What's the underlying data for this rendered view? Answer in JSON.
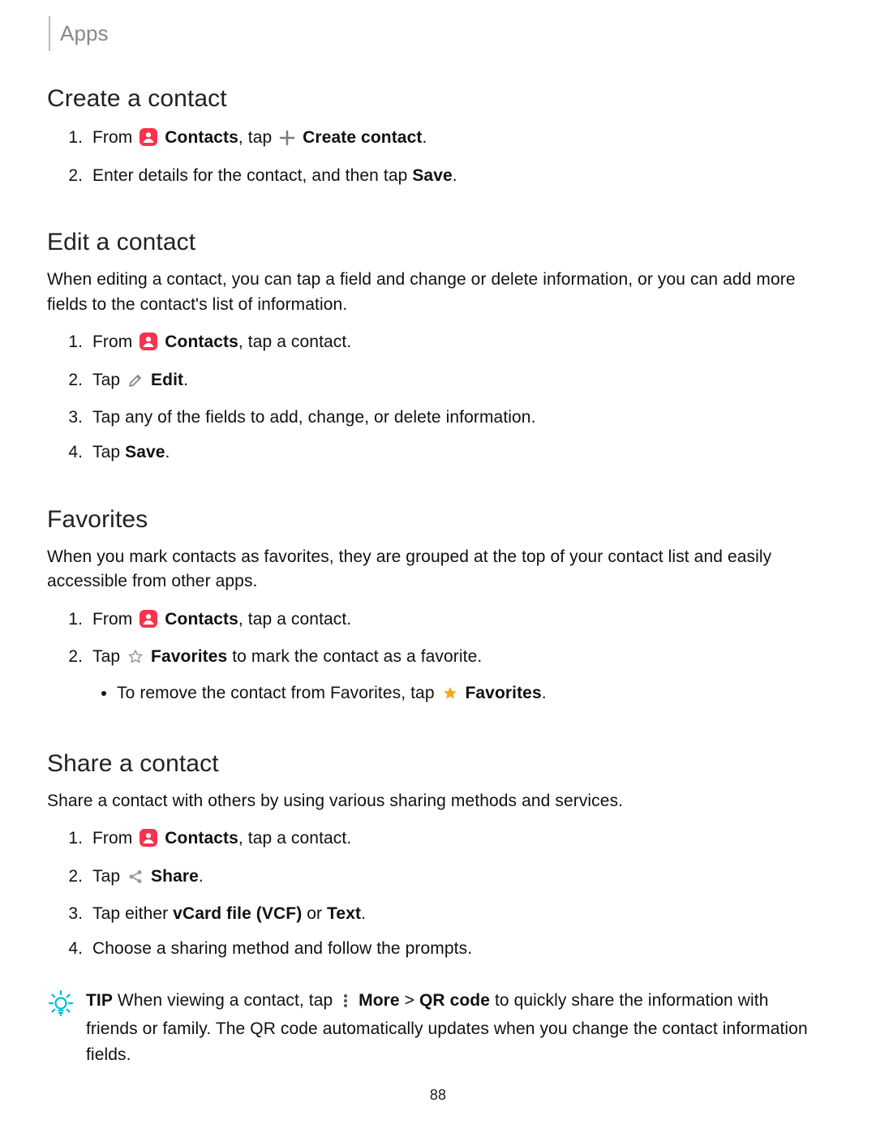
{
  "header": {
    "title": "Apps"
  },
  "section_create": {
    "heading": "Create a contact",
    "step1": {
      "pre": "From ",
      "contacts_label": "Contacts",
      "mid": ", tap ",
      "create_label": "Create contact",
      "post": "."
    },
    "step2": {
      "pre": "Enter details for the contact, and then tap ",
      "save": "Save",
      "post": "."
    }
  },
  "section_edit": {
    "heading": "Edit a contact",
    "intro": "When editing a contact, you can tap a field and change or delete information, or you can add more fields to the contact's list of information.",
    "step1": {
      "pre": "From ",
      "contacts_label": "Contacts",
      "post": ", tap a contact."
    },
    "step2": {
      "pre": "Tap ",
      "edit_label": "Edit",
      "post": "."
    },
    "step3": "Tap any of the fields to add, change, or delete information.",
    "step4": {
      "pre": "Tap ",
      "save": "Save",
      "post": "."
    }
  },
  "section_favorites": {
    "heading": "Favorites",
    "intro": "When you mark contacts as favorites, they are grouped at the top of your contact list and easily accessible from other apps.",
    "step1": {
      "pre": "From ",
      "contacts_label": "Contacts",
      "post": ", tap a contact."
    },
    "step2": {
      "pre": "Tap ",
      "fav_label": "Favorites",
      "post": " to mark the contact as a favorite."
    },
    "sub": {
      "pre": "To remove the contact from Favorites, tap ",
      "fav_label": "Favorites",
      "post": "."
    }
  },
  "section_share": {
    "heading": "Share a contact",
    "intro": "Share a contact with others by using various sharing methods and services.",
    "step1": {
      "pre": "From ",
      "contacts_label": "Contacts",
      "post": ", tap a contact."
    },
    "step2": {
      "pre": "Tap ",
      "share_label": "Share",
      "post": "."
    },
    "step3": {
      "pre": "Tap either ",
      "vcf": "vCard file (VCF)",
      "mid": " or ",
      "text": "Text",
      "post": "."
    },
    "step4": "Choose a sharing method and follow the prompts."
  },
  "tip": {
    "label": "TIP",
    "pre": "  When viewing a contact, tap ",
    "more": "More",
    "gt": " > ",
    "qr": "QR code",
    "post": " to quickly share the information with friends or family. The QR code automatically updates when you change the contact information fields."
  },
  "footer": {
    "page_number": "88"
  },
  "icons": {
    "contacts": "contacts-icon",
    "plus": "plus-icon",
    "edit": "edit-pencil-icon",
    "star_outline": "star-outline-icon",
    "star_filled": "star-filled-icon",
    "share": "share-icon",
    "more_dots": "more-vertical-icon",
    "tip_bulb": "lightbulb-tip-icon"
  },
  "colors": {
    "contacts_bg": "#f7334e",
    "star_fill": "#f5a623",
    "share_fill": "#9a9a9a",
    "plus_fill": "#7a7a7a",
    "tip_stroke": "#00bcd4",
    "pencil_stroke": "#888"
  }
}
